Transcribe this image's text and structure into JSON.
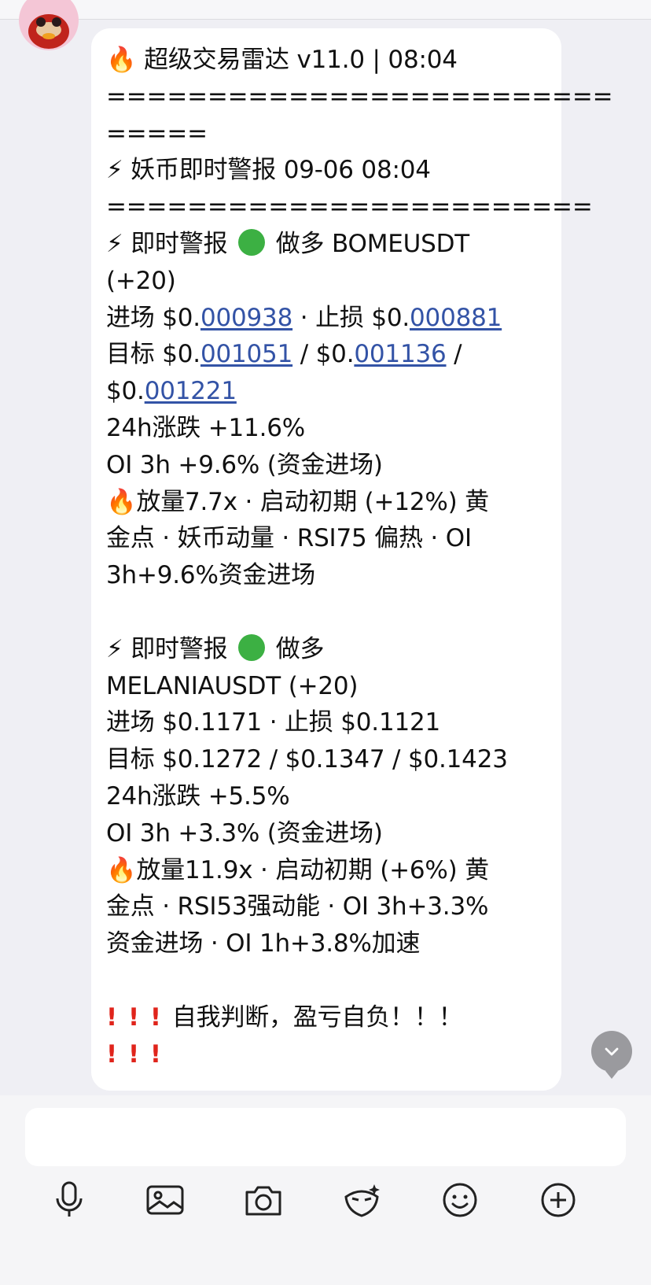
{
  "chat": {
    "lines": {
      "l1": "超级交易雷达 v11.0 | 08:04",
      "l2": "=========================",
      "l3": "=====",
      "l4": "妖币即时警报 09-06 08:04",
      "l5": "========================",
      "l6a": "即时警报",
      "l6b": "做多 BOMEUSDT",
      "l7": "(+20)",
      "l8a": "进场 $0.",
      "l8b": "000938",
      "l8c": " · 止损 $0.",
      "l8d": "000881",
      "l9a": "目标 $0.",
      "l9b": "001051",
      "l9c": " / $0.",
      "l9d": "001136",
      "l9e": " /",
      "l10a": "$0.",
      "l10b": "001221",
      "l11": "24h涨跌 +11.6%",
      "l12": "OI 3h +9.6% (资金进场)",
      "l13": "放量7.7x · 启动初期 (+12%) 黄",
      "l14": "金点 · 妖币动量 · RSI75 偏热 · OI",
      "l15": "3h+9.6%资金进场",
      "l16a": "即时警报",
      "l16b": "做多",
      "l17": "MELANIAUSDT (+20)",
      "l18": "进场 $0.1171 · 止损 $0.1121",
      "l19": "目标 $0.1272 / $0.1347 / $0.1423",
      "l20": "24h涨跌 +5.5%",
      "l21": "OI 3h +3.3% (资金进场)",
      "l22": "放量11.9x · 启动初期 (+6%) 黄",
      "l23": "金点 · RSI53强动能 · OI 3h+3.3%",
      "l24": "资金进场 · OI 1h+3.8%加速",
      "l25": "自我判断，盈亏自负！！！"
    },
    "emoji": {
      "fire": "🔥",
      "bolt": "⚡",
      "bang": "!"
    }
  },
  "toolbar": {
    "icons": [
      "mic-icon",
      "image-icon",
      "camera-icon",
      "sticker-icon",
      "emoji-icon",
      "plus-icon"
    ]
  },
  "colors": {
    "link": "#3353a6",
    "green": "#3cb043",
    "red": "#e0241b"
  }
}
